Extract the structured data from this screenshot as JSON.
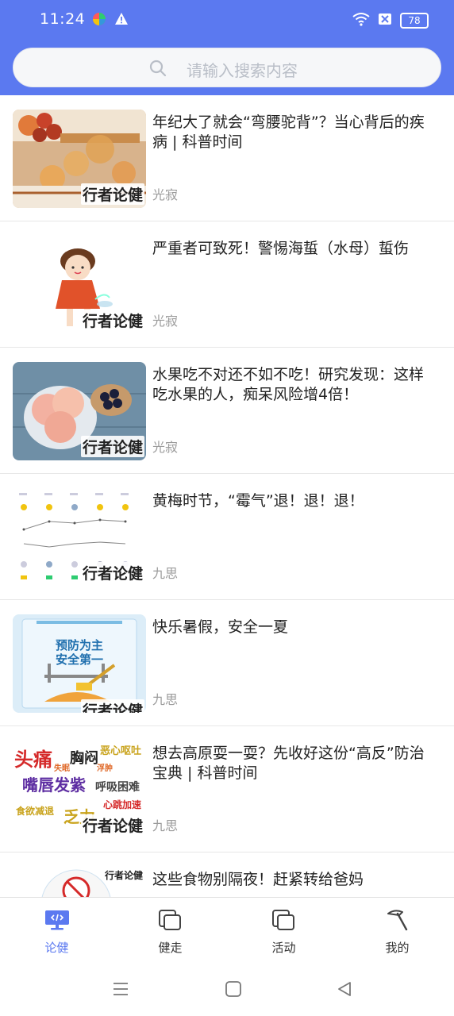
{
  "status": {
    "time": "11:24",
    "battery": "78"
  },
  "search": {
    "placeholder": "请输入搜索内容"
  },
  "articles": [
    {
      "title": "年纪大了就会“弯腰驼背”？当心背后的疾病 | 科普时间",
      "source": "光寂",
      "watermark": "行者论健",
      "thumb": "persimmon-tea"
    },
    {
      "title": "严重者可致死！警惕海蜇（水母）蜇伤",
      "source": "光寂",
      "watermark": "行者论健",
      "thumb": "girl-cartoon"
    },
    {
      "title": "水果吃不对还不如不吃！研究发现：这样吃水果的人，痴呆风险增4倍！",
      "source": "光寂",
      "watermark": "行者论健",
      "thumb": "peach-prunes"
    },
    {
      "title": "黄梅时节，“霉气”退！退！退！",
      "source": "九思",
      "watermark": "行者论健",
      "thumb": "weather-chart"
    },
    {
      "title": "快乐暑假，安全一夏",
      "source": "九思",
      "watermark": "行者论健",
      "thumb": "safety-poster",
      "poster_lines": [
        "预防为主",
        "安全第一"
      ]
    },
    {
      "title": "想去高原耍一耍？先收好这份“高反”防治宝典 | 科普时间",
      "source": "九思",
      "watermark": "行者论健",
      "thumb": "altitude-words",
      "words": [
        "头痛",
        "胸闷",
        "恶心呕吐",
        "失眠",
        "浮肿",
        "嘴唇发紫",
        "呼吸困难",
        "食欲减退",
        "心跳加速",
        "乏力"
      ]
    },
    {
      "title": "这些食物别隔夜！赶紧转给爸妈",
      "source": "",
      "watermark": "行者论健",
      "thumb": "no-sign"
    }
  ],
  "tabs": [
    {
      "label": "论健",
      "icon": "monitor-code-icon",
      "active": true
    },
    {
      "label": "健走",
      "icon": "square-copy-icon",
      "active": false
    },
    {
      "label": "活动",
      "icon": "square-copy-icon",
      "active": false
    },
    {
      "label": "我的",
      "icon": "hammer-icon",
      "active": false
    }
  ],
  "colors": {
    "accent": "#5b79f0"
  }
}
